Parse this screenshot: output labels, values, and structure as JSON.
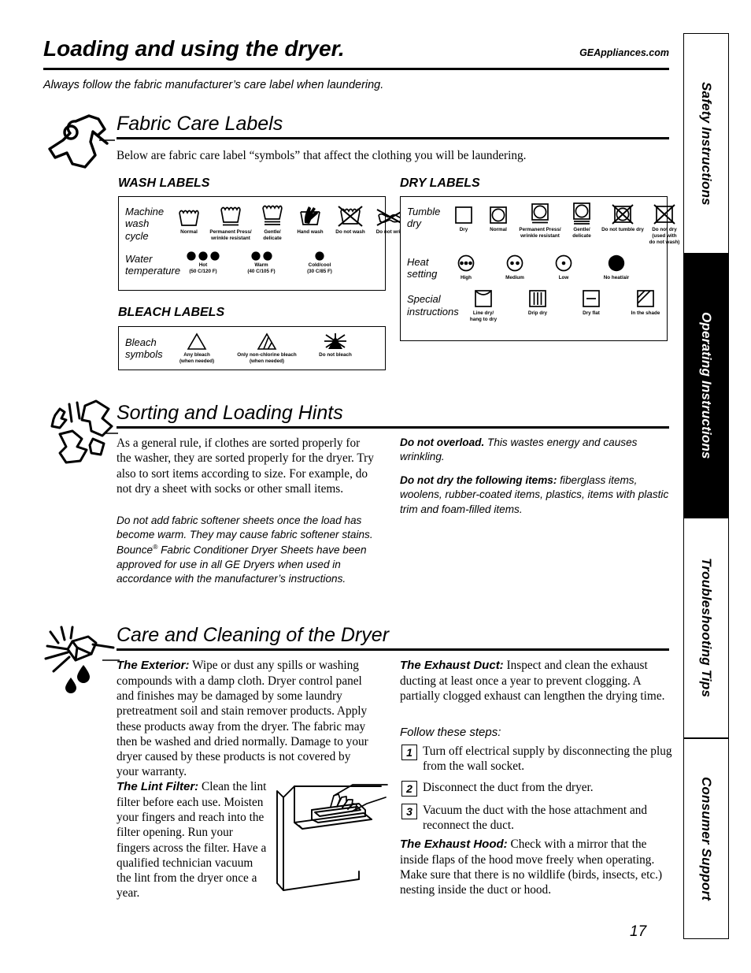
{
  "header": {
    "title": "Loading and using the dryer.",
    "site": "GEAppliances.com",
    "lede": "Always follow the fabric manufacturer’s care label when laundering."
  },
  "tabs": [
    {
      "label": "Safety Instructions",
      "active": false
    },
    {
      "label": "Operating Instructions",
      "active": true
    },
    {
      "label": "Troubleshooting Tips",
      "active": false
    },
    {
      "label": "Consumer Support",
      "active": false
    }
  ],
  "page_number": "17",
  "sections": {
    "fabric_care": {
      "heading": "Fabric Care Labels",
      "icon": "garment-icon",
      "intro": "Below are fabric care label “symbols” that affect the clothing you will be laundering.",
      "wash_heading": "WASH LABELS",
      "bleach_heading": "BLEACH LABELS",
      "dry_heading": "DRY LABELS",
      "wash": {
        "rows": [
          {
            "label": "Machine\nwash\ncycle",
            "cells": [
              {
                "icon": "wash-tub-normal",
                "caption": "Normal"
              },
              {
                "icon": "wash-tub-permanent-press",
                "caption": "Permanent Press/\nwrinkle resistant"
              },
              {
                "icon": "wash-tub-gentle",
                "caption": "Gentle/\ndelicate"
              },
              {
                "icon": "wash-tub-hand-wash",
                "caption": "Hand wash"
              },
              {
                "icon": "wash-tub-do-not-wash",
                "caption": "Do not wash"
              },
              {
                "icon": "do-not-wring",
                "caption": "Do not wring"
              }
            ]
          },
          {
            "label": "Water\ntemperature",
            "cells": [
              {
                "icon": "dots-three",
                "caption": "Hot\n(50 C/120 F)"
              },
              {
                "icon": "dots-two",
                "caption": "Warm\n(40 C/105 F)"
              },
              {
                "icon": "dots-one",
                "caption": "Cold/cool\n(30 C/85 F)"
              }
            ]
          }
        ]
      },
      "bleach": {
        "rows": [
          {
            "label": "Bleach\nsymbols",
            "cells": [
              {
                "icon": "triangle-open",
                "caption": "Any bleach\n(when needed)"
              },
              {
                "icon": "triangle-striped",
                "caption": "Only non-chlorine bleach\n(when needed)"
              },
              {
                "icon": "triangle-do-not-bleach",
                "caption": "Do not bleach"
              }
            ]
          }
        ]
      },
      "dry": {
        "rows": [
          {
            "label": "Tumble\ndry",
            "cells": [
              {
                "icon": "square-dry",
                "caption": "Dry"
              },
              {
                "icon": "square-circle-normal",
                "caption": "Normal"
              },
              {
                "icon": "square-circle-permanent-press",
                "caption": "Permanent Press/\nwrinkle resistant"
              },
              {
                "icon": "square-circle-gentle",
                "caption": "Gentle/\ndelicate"
              },
              {
                "icon": "do-not-tumble-dry",
                "caption": "Do not tumble dry"
              },
              {
                "icon": "do-not-dry",
                "caption": "Do not dry\n(used with\ndo not wash)"
              }
            ]
          },
          {
            "label": "Heat\nsetting",
            "cells": [
              {
                "icon": "circle-dots-three",
                "caption": "High"
              },
              {
                "icon": "circle-dots-two",
                "caption": "Medium"
              },
              {
                "icon": "circle-dots-one",
                "caption": "Low"
              },
              {
                "icon": "circle-filled",
                "caption": "No heat/air"
              }
            ]
          },
          {
            "label": "Special\ninstructions",
            "cells": [
              {
                "icon": "line-dry",
                "caption": "Line dry/\nhang to dry"
              },
              {
                "icon": "drip-dry",
                "caption": "Drip dry"
              },
              {
                "icon": "dry-flat",
                "caption": "Dry flat"
              },
              {
                "icon": "in-the-shade",
                "caption": "In the shade"
              }
            ]
          }
        ]
      }
    },
    "sorting": {
      "heading": "Sorting and Loading Hints",
      "icon": "tumbling-clothes-icon",
      "left_p1": "As a general rule, if clothes are sorted properly for the washer, they are sorted properly for the dryer. Try also to sort items according to size. For example, do not dry a sheet with socks or other small items.",
      "left_p2_a": "Do not add fabric softener sheets once the load has become warm. They may cause fabric softener stains. Bounce",
      "left_p2_sup": "®",
      "left_p2_b": " Fabric Conditioner Dryer Sheets have been approved for use in all GE Dryers when used in accordance with the manufacturer’s instructions.",
      "right_p1_lead": "Do not overload.",
      "right_p1_body": " This wastes energy and causes wrinkling.",
      "right_p2_lead": "Do not dry the following items:",
      "right_p2_body": " fiberglass items, woolens, rubber-coated items, plastics, items with plastic trim and foam-filled items."
    },
    "care": {
      "heading": "Care and Cleaning of the Dryer",
      "icon": "sponge-with-drops-icon",
      "exterior_lead": "The Exterior:",
      "exterior_body": " Wipe or dust any spills or washing compounds with a damp cloth. Dryer control panel and finishes may be damaged by some laundry pretreatment soil and stain remover products. Apply these products away from the dryer. The fabric may then be washed and dried normally. Damage to your dryer caused by these products is not covered by your warranty.",
      "lint_lead": "The Lint Filter:",
      "lint_body": " Clean the lint filter before each use. Moisten your fingers and reach into the filter opening. Run your fingers across the filter. Have a qualified technician vacuum the lint from the dryer once a year.",
      "lint_illustration": "dryer-lint-filter-illustration",
      "duct_lead": "The Exhaust Duct:",
      "duct_body": " Inspect and clean the exhaust ducting at least once a year to prevent clogging. A partially clogged exhaust can lengthen the drying time.",
      "steps_intro": "Follow these steps:",
      "steps": [
        {
          "num": "1",
          "text": "Turn off electrical supply by disconnecting the plug from the wall socket."
        },
        {
          "num": "2",
          "text": "Disconnect the duct from the dryer."
        },
        {
          "num": "3",
          "text": "Vacuum the duct with the hose attachment and reconnect the duct."
        }
      ],
      "hood_lead": "The Exhaust Hood:",
      "hood_body": " Check with a mirror that the inside flaps of the hood move freely when operating. Make sure that there is no wildlife (birds, insects, etc.) nesting inside the duct or hood."
    }
  }
}
